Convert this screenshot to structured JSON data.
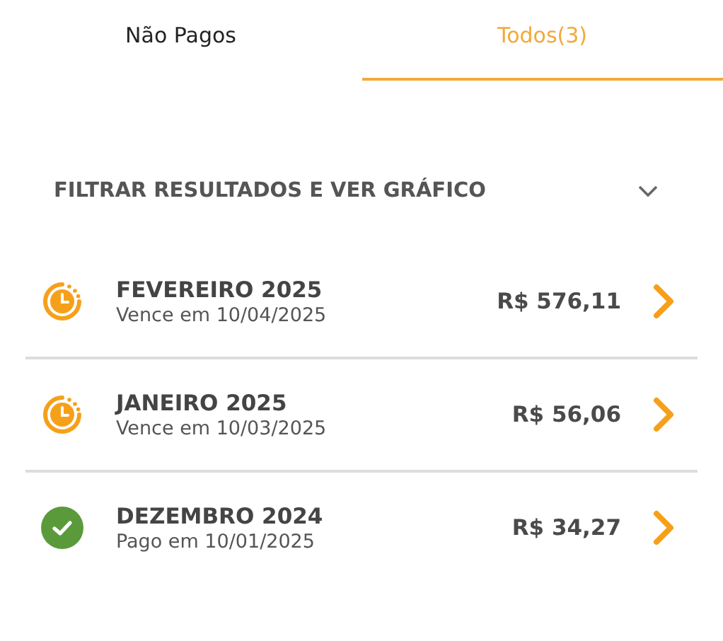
{
  "tabs": [
    {
      "label": "Não Pagos",
      "selected": false
    },
    {
      "label": "Todos(3)",
      "selected": true
    }
  ],
  "filter": {
    "label": "FILTRAR RESULTADOS E VER GRÁFICO",
    "expanded": false
  },
  "bills": [
    {
      "kind": "pending",
      "title": "FEVEREIRO 2025",
      "subtitle": "Vence em 10/04/2025",
      "amount": "R$ 576,11"
    },
    {
      "kind": "pending",
      "title": "JANEIRO 2025",
      "subtitle": "Vence em 10/03/2025",
      "amount": "R$ 56,06"
    },
    {
      "kind": "paid",
      "title": "DEZEMBRO 2024",
      "subtitle": "Pago em 10/01/2025",
      "amount": "R$ 34,27"
    }
  ]
}
